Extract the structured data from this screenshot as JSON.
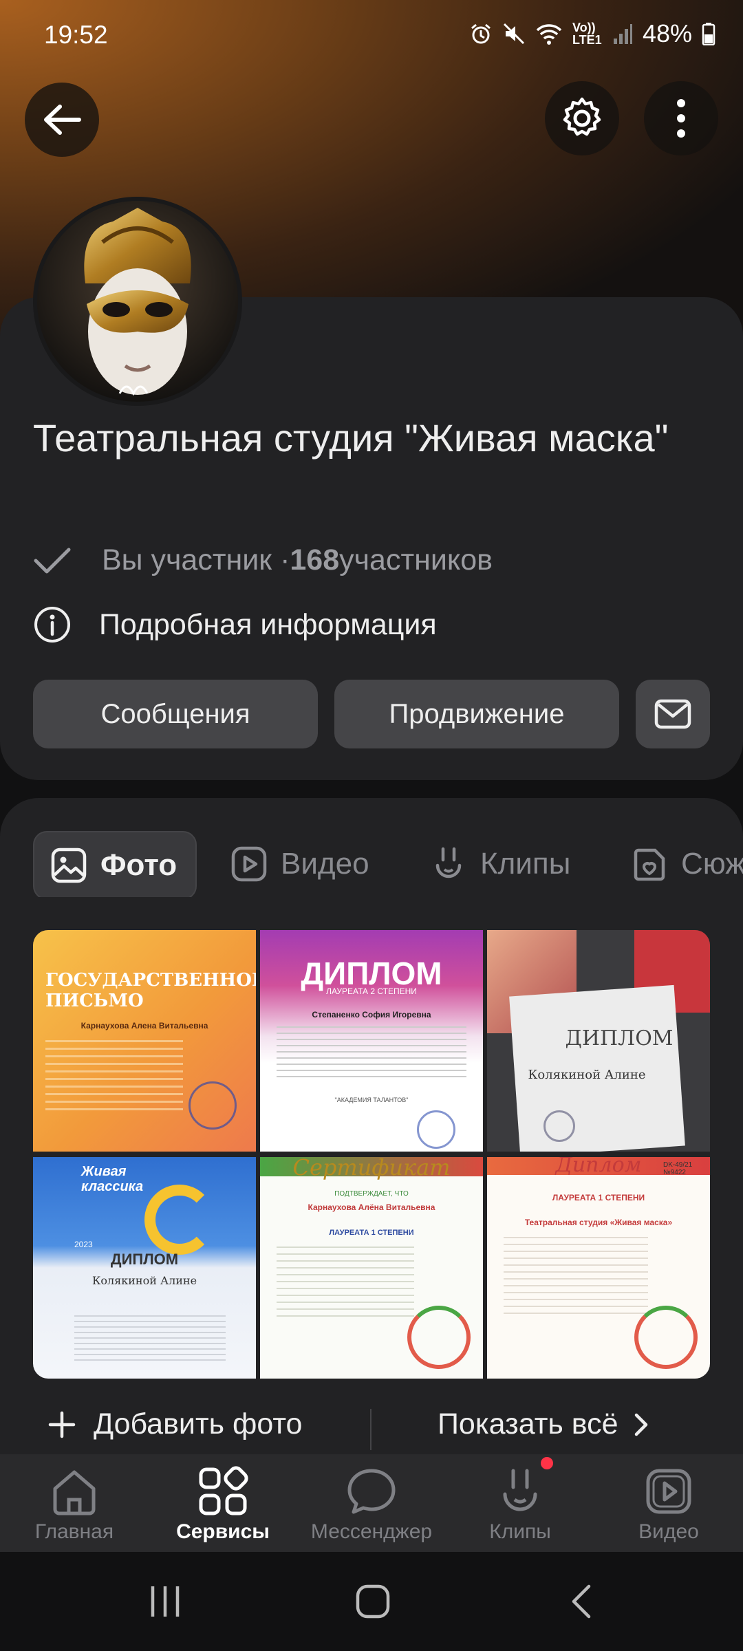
{
  "status_bar": {
    "time": "19:52",
    "network": "Vo)) LTE1",
    "battery": "48%"
  },
  "header": {
    "back_icon": "arrow-left-icon",
    "settings_icon": "gear-icon",
    "more_icon": "more-vertical-icon"
  },
  "group": {
    "title": "Театральная студия \"Живая маска\"",
    "member_status": "Вы участник · ",
    "member_count": "168",
    "member_suffix": " участников",
    "info_label": "Подробная информация"
  },
  "actions": {
    "messages": "Сообщения",
    "promotion": "Продвижение",
    "mail_icon": "mail-icon"
  },
  "tabs": [
    {
      "label": "Фото",
      "icon": "photo-icon"
    },
    {
      "label": "Видео",
      "icon": "video-icon"
    },
    {
      "label": "Клипы",
      "icon": "clips-icon"
    },
    {
      "label": "Сюж",
      "icon": "story-icon"
    }
  ],
  "photos": {
    "p1": {
      "title": "ГОСУДАРСТВЕННОЕ ПИСЬМО",
      "name": "Карнаухова Алена Витальевна"
    },
    "p2": {
      "title": "ДИПЛОМ",
      "subtitle": "ЛАУРЕАТА 2 СТЕПЕНИ",
      "name": "Степаненко София Игоревна",
      "footer": "\"АКАДЕМИЯ ТАЛАНТОВ\""
    },
    "p3": {
      "title": "ДИПЛОМ",
      "name": "Колякиной Алине"
    },
    "p4": {
      "brand": "Живая классика",
      "title": "ДИПЛОМ",
      "name": "Колякиной Алине",
      "year": "2023"
    },
    "p5": {
      "title": "Сертификат",
      "line": "ПОДТВЕРЖДАЕТ, ЧТО",
      "name": "Карнаухова Алёна Витальевна",
      "degree": "ЛАУРЕАТА 1 СТЕПЕНИ"
    },
    "p6": {
      "title": "Диплом",
      "degree": "ЛАУРЕАТА 1 СТЕПЕНИ",
      "name": "Театральная студия «Живая маска»",
      "code": "DK-49/21 №9422"
    }
  },
  "footer_actions": {
    "add_photo": "Добавить фото",
    "show_all": "Показать всё"
  },
  "bottom_nav": [
    {
      "label": "Главная",
      "icon": "home-icon"
    },
    {
      "label": "Сервисы",
      "icon": "services-icon"
    },
    {
      "label": "Мессенджер",
      "icon": "messenger-icon"
    },
    {
      "label": "Клипы",
      "icon": "clips-icon"
    },
    {
      "label": "Видео",
      "icon": "video-icon"
    }
  ]
}
